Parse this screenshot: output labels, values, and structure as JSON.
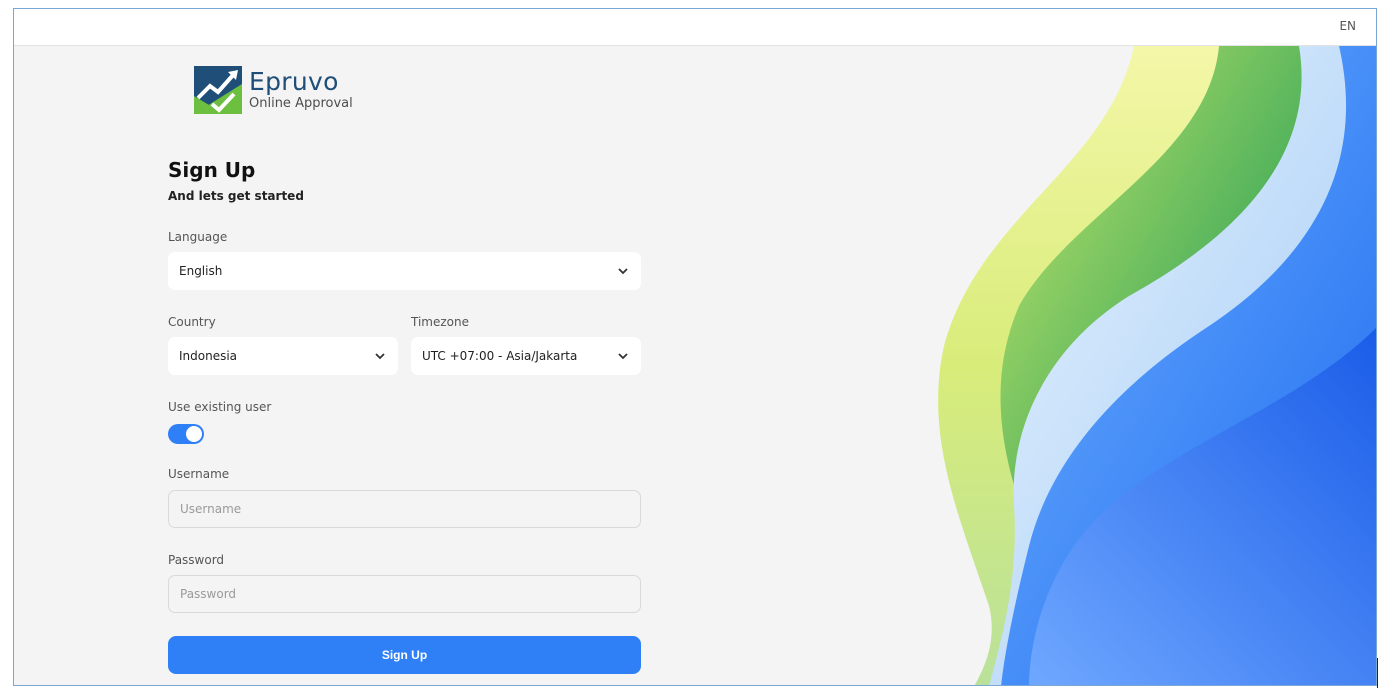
{
  "header": {
    "language_code": "EN"
  },
  "brand": {
    "name": "Epruvo",
    "tagline": "Online Approval",
    "icon": "chart-check-logo",
    "colors": {
      "blue": "#1f4e79",
      "green": "#6cbf3f"
    }
  },
  "form": {
    "title": "Sign Up",
    "subtitle": "And lets get started",
    "language": {
      "label": "Language",
      "value": "English"
    },
    "country": {
      "label": "Country",
      "value": "Indonesia"
    },
    "timezone": {
      "label": "Timezone",
      "value": "UTC +07:00 - Asia/Jakarta"
    },
    "existing_user": {
      "label": "Use existing user",
      "enabled": true
    },
    "username": {
      "label": "Username",
      "placeholder": "Username",
      "value": ""
    },
    "password": {
      "label": "Password",
      "placeholder": "Password",
      "value": ""
    },
    "submit_label": "Sign Up"
  },
  "colors": {
    "accent": "#2f80f7",
    "background": "#f4f4f4"
  }
}
